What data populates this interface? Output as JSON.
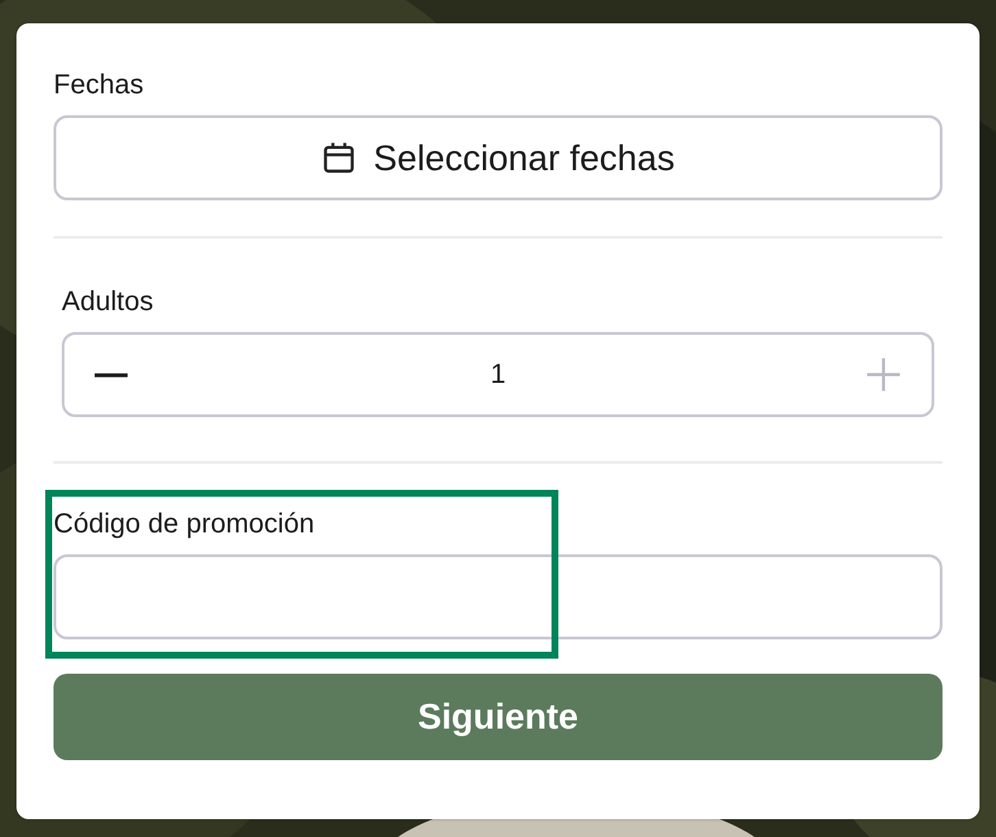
{
  "sections": [
    {
      "kind": "dates",
      "label": "Fechas",
      "button": "Seleccionar fechas"
    },
    {
      "kind": "stepper",
      "label": "Adultos",
      "value": "1",
      "decrement": {
        "disabled": false
      },
      "increment": {
        "disabled": true
      }
    },
    {
      "kind": "text",
      "label": "Código de promoción",
      "highlighted": true
    }
  ],
  "submit": {
    "label": "Siguiente"
  }
}
